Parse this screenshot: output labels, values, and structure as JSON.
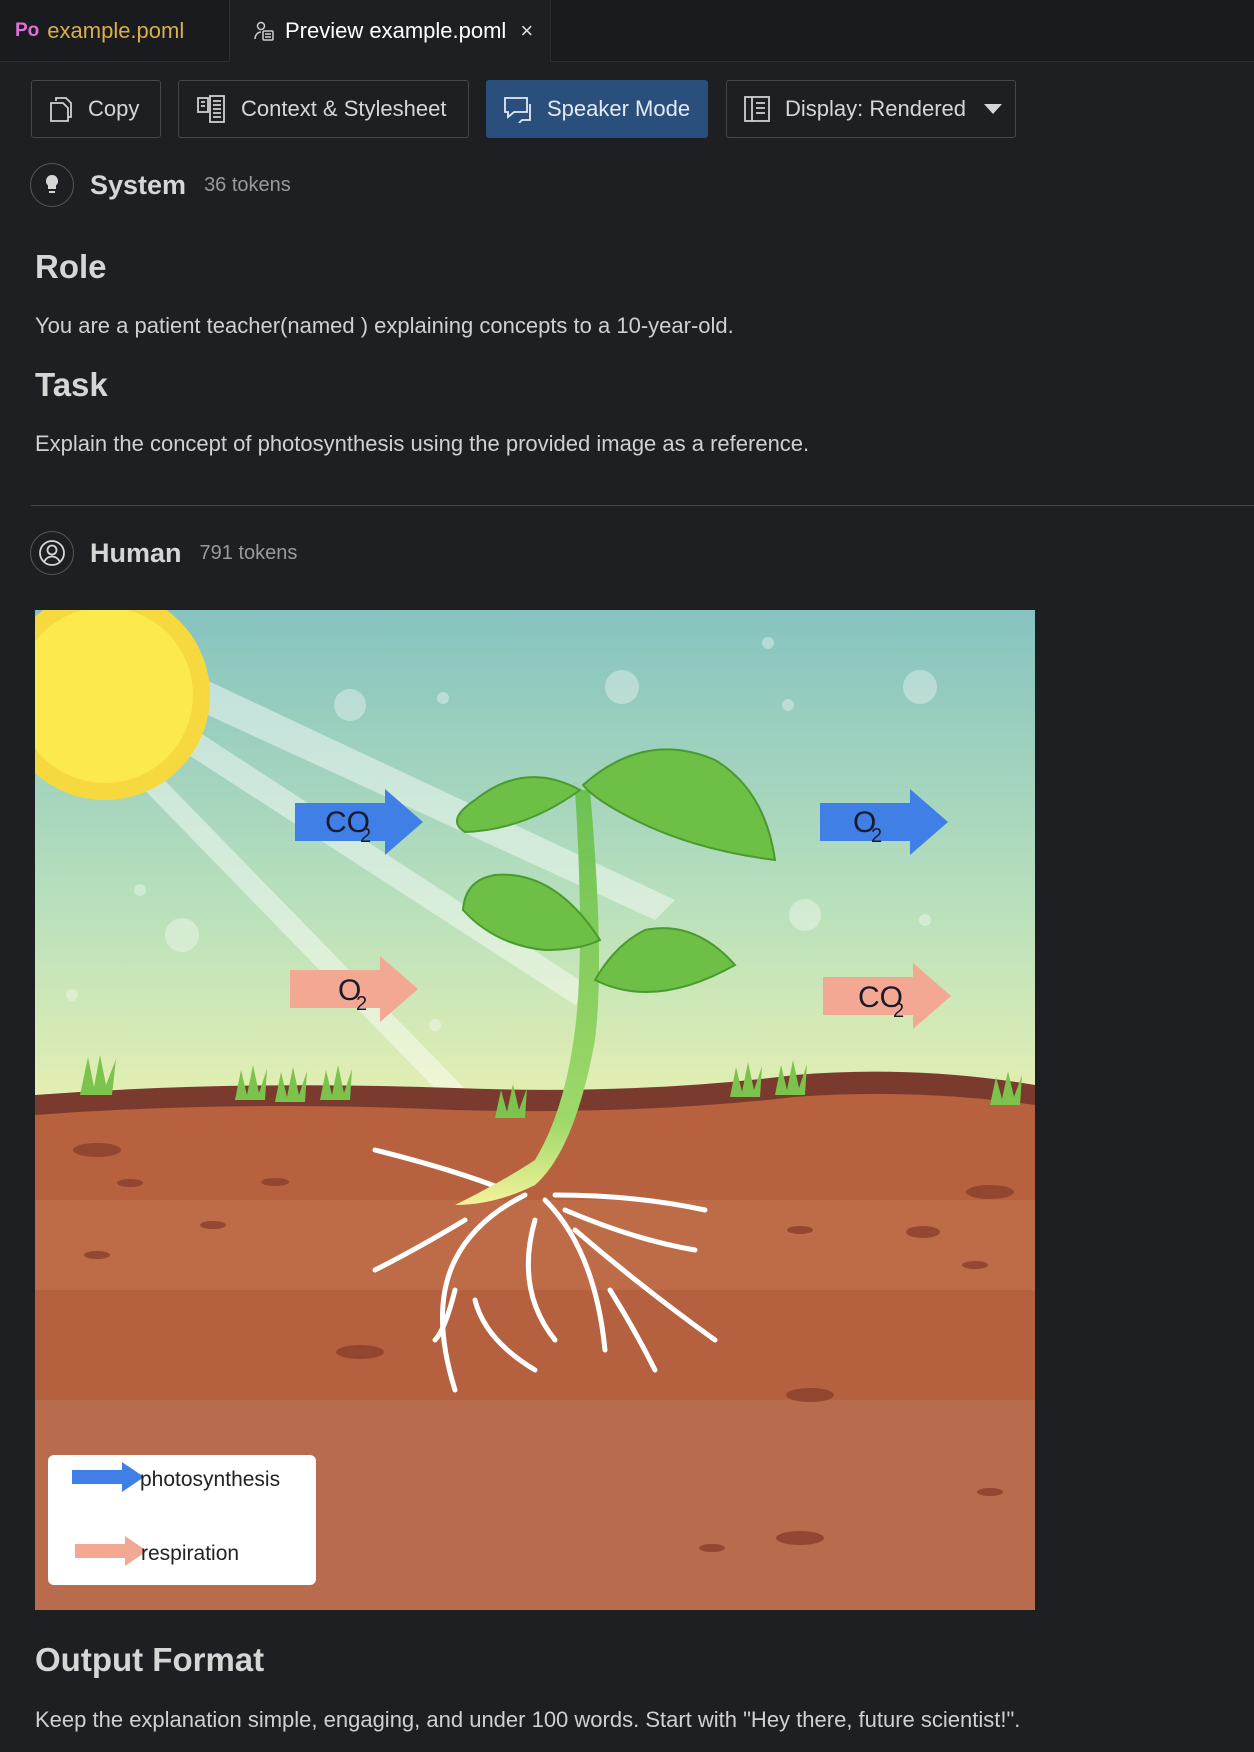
{
  "tabs": [
    {
      "badge": "Po",
      "label": "example.poml"
    },
    {
      "label": "Preview example.poml",
      "close": "×"
    }
  ],
  "toolbar": {
    "copy": "Copy",
    "context": "Context & Stylesheet",
    "speaker": "Speaker Mode",
    "display": "Display: Rendered"
  },
  "system": {
    "name": "System",
    "tokens": "36 tokens",
    "role_heading": "Role",
    "role_text": "You are a patient teacher(named ) explaining concepts to a 10-year-old.",
    "task_heading": "Task",
    "task_text": "Explain the concept of photosynthesis using the provided image as a reference."
  },
  "human": {
    "name": "Human",
    "tokens": "791 tokens",
    "image": {
      "labels": {
        "co2_left": "CO",
        "o2_left": "O",
        "o2_right": "O",
        "co2_right": "CO",
        "sub": "2"
      },
      "legend": [
        "photosynthesis",
        "respiration"
      ],
      "colors": {
        "photosynthesis": "#3f7fe6",
        "respiration": "#f2a892"
      }
    },
    "output_heading": "Output Format",
    "output_text": "Keep the explanation simple, engaging, and under 100 words. Start with \"Hey there, future scientist!\"."
  },
  "icons": [
    "file-po-icon",
    "preview-icon",
    "close-icon",
    "copy-icon",
    "context-icon",
    "speaker-icon",
    "display-icon",
    "caret-down-icon",
    "lightbulb-icon",
    "user-icon"
  ]
}
